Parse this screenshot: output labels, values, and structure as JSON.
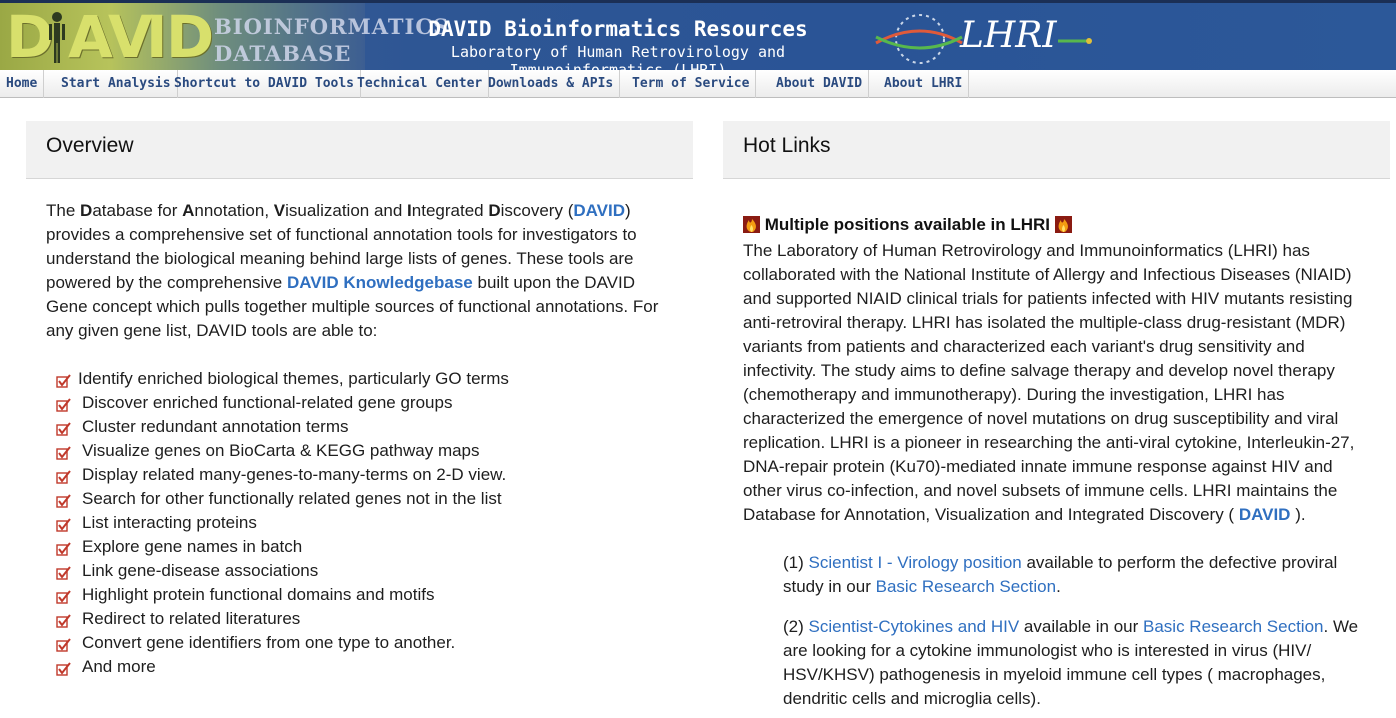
{
  "header": {
    "logo_letters": [
      "D",
      "A",
      "V",
      "I",
      "D"
    ],
    "logo_sub_line1": "BIOINFORMATICS",
    "logo_sub_line2": "DATABASE",
    "title": "DAVID Bioinformatics Resources",
    "subtitle": "Laboratory of Human Retrovirology and Immunoinformatics (LHRI)",
    "partner_logo_text": "LHRI"
  },
  "nav": {
    "items": [
      {
        "label": "Home"
      },
      {
        "label": "Start Analysis"
      },
      {
        "label": "Shortcut to DAVID Tools"
      },
      {
        "label": "Technical Center"
      },
      {
        "label": "Downloads & APIs"
      },
      {
        "label": "Term of Service"
      },
      {
        "label": "About DAVID"
      },
      {
        "label": "About LHRI"
      }
    ]
  },
  "overview": {
    "heading": "Overview",
    "intro": {
      "the": "The ",
      "d1": "D",
      "atabase": "atabase for ",
      "a1": "A",
      "nnotation": "nnotation, ",
      "v1": "V",
      "isualization": "isualization and ",
      "i1": "I",
      "ntegrated": "ntegrated ",
      "d2": "D",
      "iscovery": "iscovery (",
      "david_link": "DAVID",
      "part2": ") provides a comprehensive set of functional annotation tools for investigators to understand the biological meaning behind large lists of genes. These tools are powered by the comprehensive ",
      "knowledgebase_link": "DAVID Knowledgebase",
      "part3": " built upon the DAVID Gene concept which pulls together multiple sources of functional annotations. For any given gene list, DAVID tools are able to:"
    },
    "features": [
      "Identify enriched biological themes, particularly GO terms",
      "Discover enriched functional-related gene groups",
      "Cluster redundant annotation terms",
      "Visualize genes on BioCarta & KEGG pathway maps",
      "Display related many-genes-to-many-terms on 2-D view.",
      "Search for other functionally related genes not in the list",
      "List interacting proteins",
      "Explore gene names in batch",
      "Link gene-disease associations",
      "Highlight protein functional domains and motifs",
      "Redirect to related literatures",
      "Convert gene identifiers from one type to another.",
      "And more"
    ],
    "check_icon_color": "#c0392b"
  },
  "hot_links": {
    "heading": "Hot Links",
    "title": "Multiple positions available in LHRI",
    "body_text": "The Laboratory of Human Retrovirology and Immunoinformatics (LHRI) has collaborated with the National Institute of Allergy and Infectious Diseases (NIAID) and supported NIAID clinical trials for patients infected with HIV mutants resisting anti-retroviral therapy. LHRI has isolated the multiple-class drug-resistant (MDR) variants from patients and characterized each variant's drug sensitivity and infectivity. The study aims to define salvage therapy and develop novel therapy (chemotherapy and immunotherapy). During the investigation, LHRI has characterized the emergence of novel mutations on drug susceptibility and viral replication. LHRI is a pioneer in researching the anti-viral cytokine, Interleukin-27, DNA-repair protein (Ku70)-mediated innate immune response against HIV and other virus co-infection, and novel subsets of immune cells. LHRI maintains the Database for Annotation, Visualization and Integrated Discovery ( ",
    "body_link": "DAVID",
    "body_end": " ).",
    "position1": {
      "num": "(1) ",
      "link": "Scientist I - Virology position",
      "text": " available to perform the defective proviral study in our ",
      "link2": "Basic Research Section",
      "end": "."
    },
    "position2": {
      "num": "(2) ",
      "link": "Scientist-Cytokines and HIV",
      "text": " available in our ",
      "link2": "Basic Research Section",
      "end": ". We are looking for a cytokine immunologist who is interested in virus (HIV/ HSV/KHSV) pathogenesis in myeloid immune cell types ( macrophages, dendritic cells and microglia cells)."
    }
  },
  "colors": {
    "link": "#2f6fc0",
    "nav_text": "#2a4a7f",
    "banner": "#2a5496"
  }
}
